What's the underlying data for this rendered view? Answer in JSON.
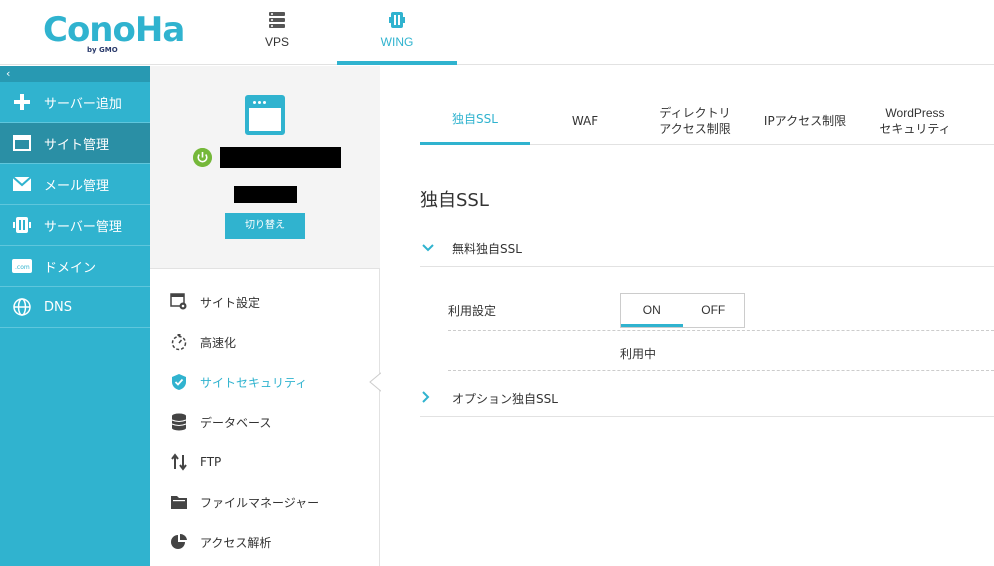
{
  "header": {
    "logo_text": "ConoHa",
    "logo_sub": "by GMO",
    "tabs": [
      {
        "label": "VPS",
        "icon": "server-icon"
      },
      {
        "label": "WING",
        "icon": "wing-icon"
      }
    ]
  },
  "sidebar": {
    "collapse": "‹",
    "items": [
      {
        "label": "サーバー追加",
        "icon": "plus-icon"
      },
      {
        "label": "サイト管理",
        "icon": "window-icon"
      },
      {
        "label": "メール管理",
        "icon": "mail-icon"
      },
      {
        "label": "サーバー管理",
        "icon": "server-manage-icon"
      },
      {
        "label": "ドメイン",
        "icon": "domain-icon"
      },
      {
        "label": "DNS",
        "icon": "globe-icon"
      }
    ]
  },
  "site_panel": {
    "switch_label": "切り替え",
    "menu": [
      {
        "label": "サイト設定",
        "icon": "site-settings-icon"
      },
      {
        "label": "高速化",
        "icon": "stopwatch-icon"
      },
      {
        "label": "サイトセキュリティ",
        "icon": "shield-icon"
      },
      {
        "label": "データベース",
        "icon": "database-icon"
      },
      {
        "label": "FTP",
        "icon": "transfer-icon"
      },
      {
        "label": "ファイルマネージャー",
        "icon": "folder-icon"
      },
      {
        "label": "アクセス解析",
        "icon": "pie-chart-icon"
      }
    ]
  },
  "content": {
    "tabs": [
      {
        "line1": "独自SSL",
        "line2": ""
      },
      {
        "line1": "WAF",
        "line2": ""
      },
      {
        "line1": "ディレクトリ",
        "line2": "アクセス制限"
      },
      {
        "line1": "IPアクセス制限",
        "line2": ""
      },
      {
        "line1": "WordPress",
        "line2": "セキュリティ"
      }
    ],
    "title": "独自SSL",
    "free_ssl": "無料独自SSL",
    "setting_label": "利用設定",
    "toggle": {
      "on": "ON",
      "off": "OFF",
      "selected": "ON"
    },
    "status": "利用中",
    "option_ssl": "オプション独自SSL"
  },
  "colors": {
    "accent": "#30b3cf",
    "sidebar_active": "#2a8fa5",
    "power": "#75b83a"
  }
}
